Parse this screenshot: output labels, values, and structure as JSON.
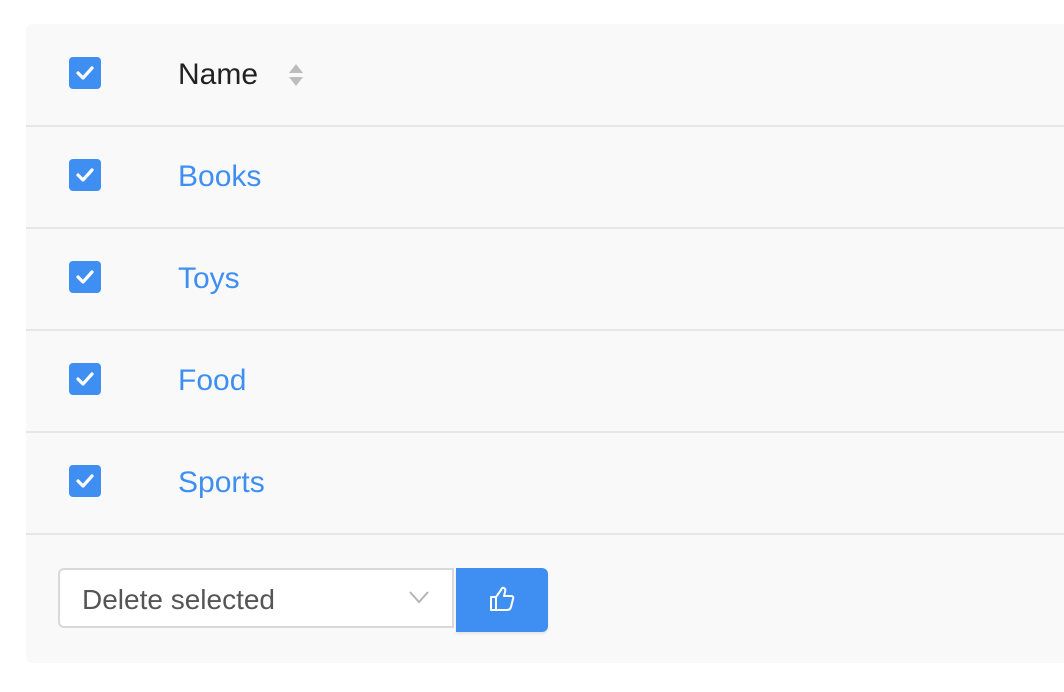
{
  "table": {
    "header": {
      "select_all_checked": true,
      "column_name": "Name",
      "sort_icon": "sort-up-down-icon"
    },
    "rows": [
      {
        "name": "Books",
        "checked": true
      },
      {
        "name": "Toys",
        "checked": true
      },
      {
        "name": "Food",
        "checked": true
      },
      {
        "name": "Sports",
        "checked": true
      }
    ]
  },
  "actions": {
    "selected_action": "Delete selected",
    "submit_icon": "thumbs-up-icon"
  },
  "colors": {
    "accent": "#3f8ff3",
    "panel_background": "#f9f9f9",
    "divider": "#e6e6e6"
  }
}
